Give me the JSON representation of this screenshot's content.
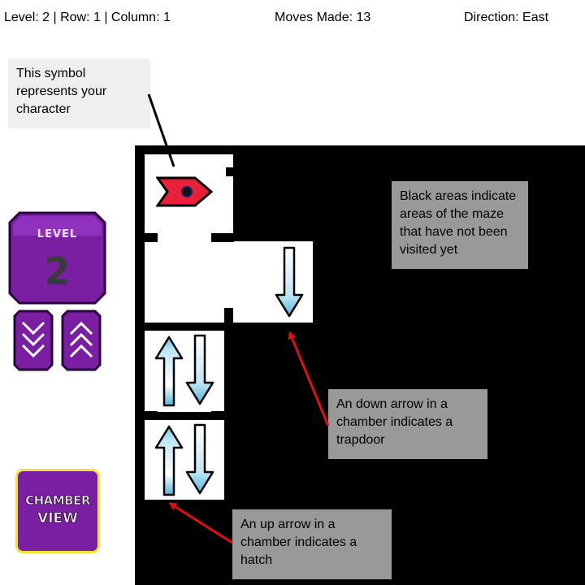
{
  "status": {
    "level_row_col": "Level: 2 | Row: 1 | Column: 1",
    "moves": "Moves Made: 13",
    "direction": "Direction: East"
  },
  "callouts": {
    "character": "This symbol represents your character",
    "unvisited": "Black areas indicate areas of the maze that have not been visited yet",
    "trapdoor": "An down arrow in a chamber indicates a trapdoor",
    "hatch": "An up arrow in a chamber indicates a hatch"
  },
  "level_badge": {
    "word": "LEVEL",
    "number": "2"
  },
  "chamber_view": {
    "line1": "CHAMBER",
    "line2": "VIEW"
  },
  "colors": {
    "purple": "#7b1fa2",
    "purple_light": "#9c3fcf",
    "purple_dark": "#4a0f66",
    "character_red": "#e8203a",
    "arrow_blue": "#6fc6e8",
    "callout_arrow": "#e01010",
    "gold_border": "#f2e13a"
  },
  "icons": {
    "character": "character-flag-icon",
    "trapdoor": "down-arrow-icon",
    "hatch": "up-arrow-icon",
    "level_down": "double-chevron-down-icon",
    "level_up": "double-chevron-up-icon"
  }
}
